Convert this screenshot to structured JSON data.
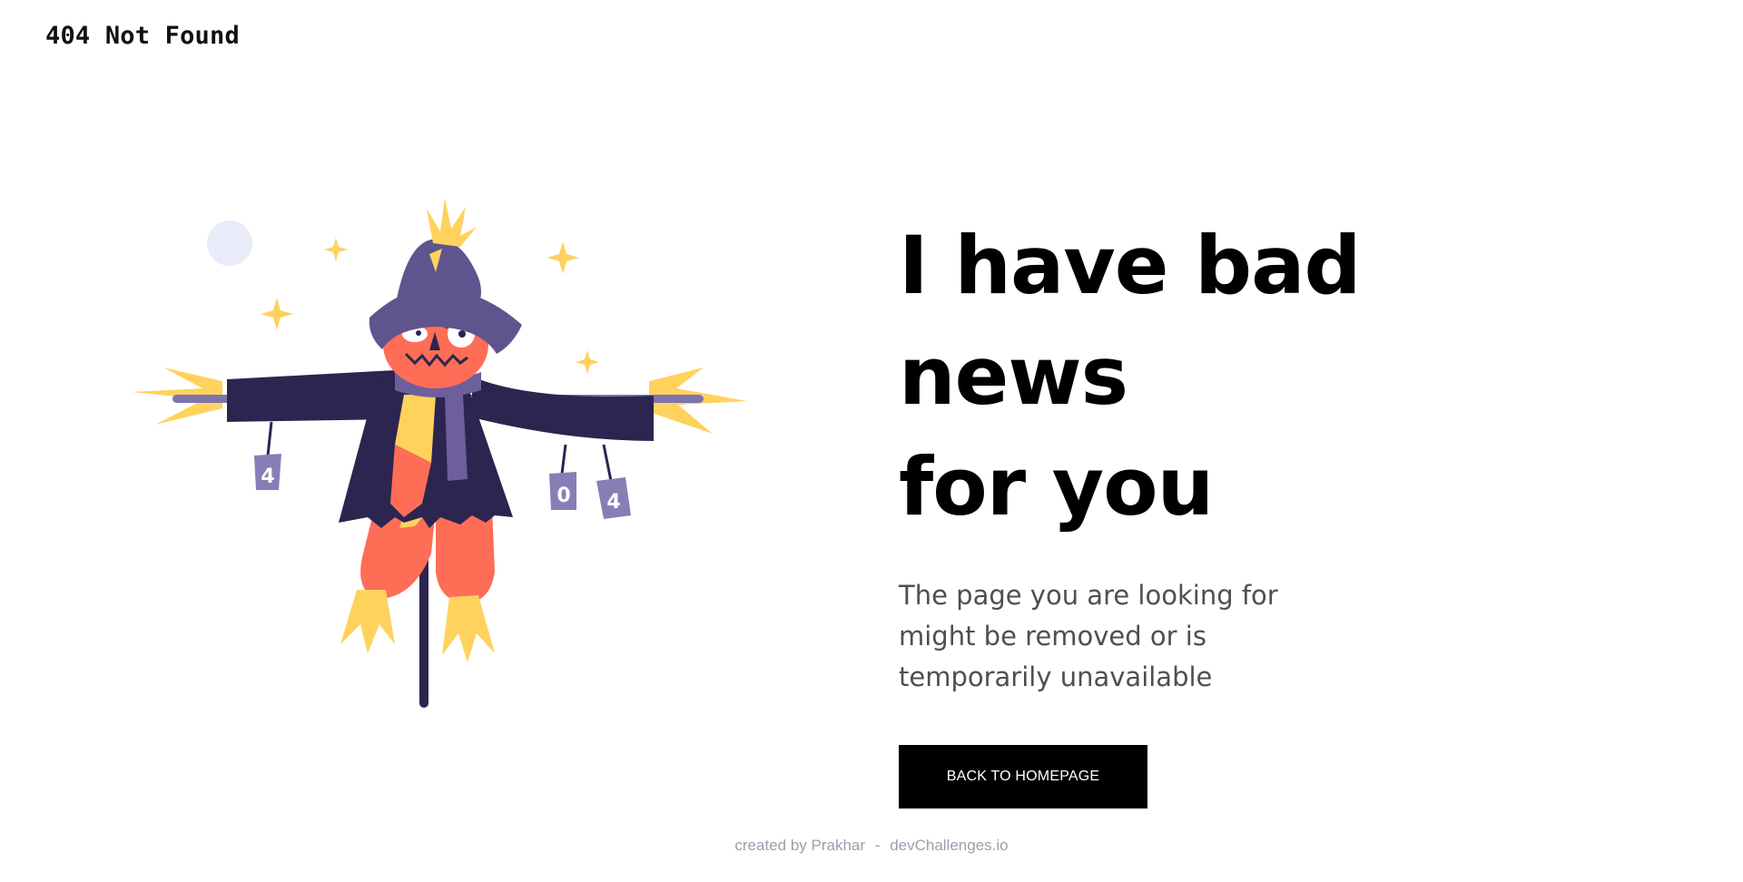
{
  "header": {
    "brand_text": "404 Not Found"
  },
  "illustration": {
    "cans": [
      "4",
      "0",
      "4"
    ],
    "colors": {
      "hat": "#5e548e",
      "coat": "#2b2550",
      "face": "#fe6d56",
      "straw": "#ffd25e",
      "scarf": "#6d5f9b",
      "pole": "#2b2550",
      "moon": "#e9ecf8",
      "can": "#877eb5"
    }
  },
  "main": {
    "headline_line1": "I have bad news",
    "headline_line2": "for you",
    "description_line1": "The page you are looking for",
    "description_line2": "might be removed or is",
    "description_line3": "temporarily unavailable",
    "cta_label": "BACK TO HOMEPAGE"
  },
  "footer": {
    "credit_prefix": "created by",
    "author": "Prakhar",
    "separator": "-",
    "site": "devChallenges.io"
  }
}
